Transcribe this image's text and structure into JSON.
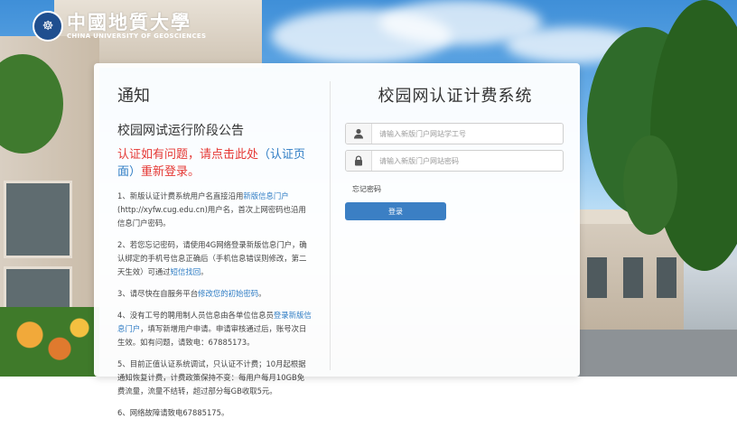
{
  "logo": {
    "name_cn": "中國地質大學",
    "name_en": "CHINA UNIVERSITY OF GEOSCIENCES",
    "seal_glyph": "☸"
  },
  "notice": {
    "title": "通知",
    "subtitle": "校园网试运行阶段公告",
    "alert_prefix": "认证如有问题，请点击此处",
    "alert_link": "（认证页面）",
    "alert_suffix": "重新登录。",
    "items": [
      {
        "before": "1、新版认证计费系统用户名直接沿用",
        "link": "新版信息门户",
        "after": "(http://xyfw.cug.edu.cn)用户名，首次上网密码也沿用信息门户密码。"
      },
      {
        "before": "2、若您忘记密码，请使用4G网络登录新版信息门户，确认绑定的手机号信息正确后（手机信息错误则修改，第二天生效）可通过",
        "link": "短信找回",
        "after": "。"
      },
      {
        "before": "3、请尽快在自服务平台",
        "link": "修改您的初始密码",
        "after": "。"
      },
      {
        "before": "4、没有工号的聘用制人员信息由各单位信息员",
        "link": "登录新版信息门户",
        "after": "，填写新增用户申请。申请审核通过后，账号次日生效。如有问题，请致电：67885173。"
      },
      {
        "before": "5、目前正值认证系统调试，只认证不计费；10月起根据通知恢复计费，计费政策保持不变：每用户每月10GB免费流量，流量不结转，超过部分每GB收取5元。",
        "link": "",
        "after": ""
      },
      {
        "before": "6、网络故障请致电67885175。",
        "link": "",
        "after": ""
      }
    ]
  },
  "login": {
    "title": "校园网认证计费系统",
    "username_placeholder": "请输入新版门户网站学工号",
    "password_placeholder": "请输入新版门户网站密码",
    "forgot_label": "忘记密码",
    "submit_label": "登录"
  },
  "colors": {
    "alert": "#e53935",
    "link": "#2e7cc4",
    "button": "#3b7fc4"
  },
  "icons": {
    "username": "user-icon",
    "password": "lock-icon"
  }
}
